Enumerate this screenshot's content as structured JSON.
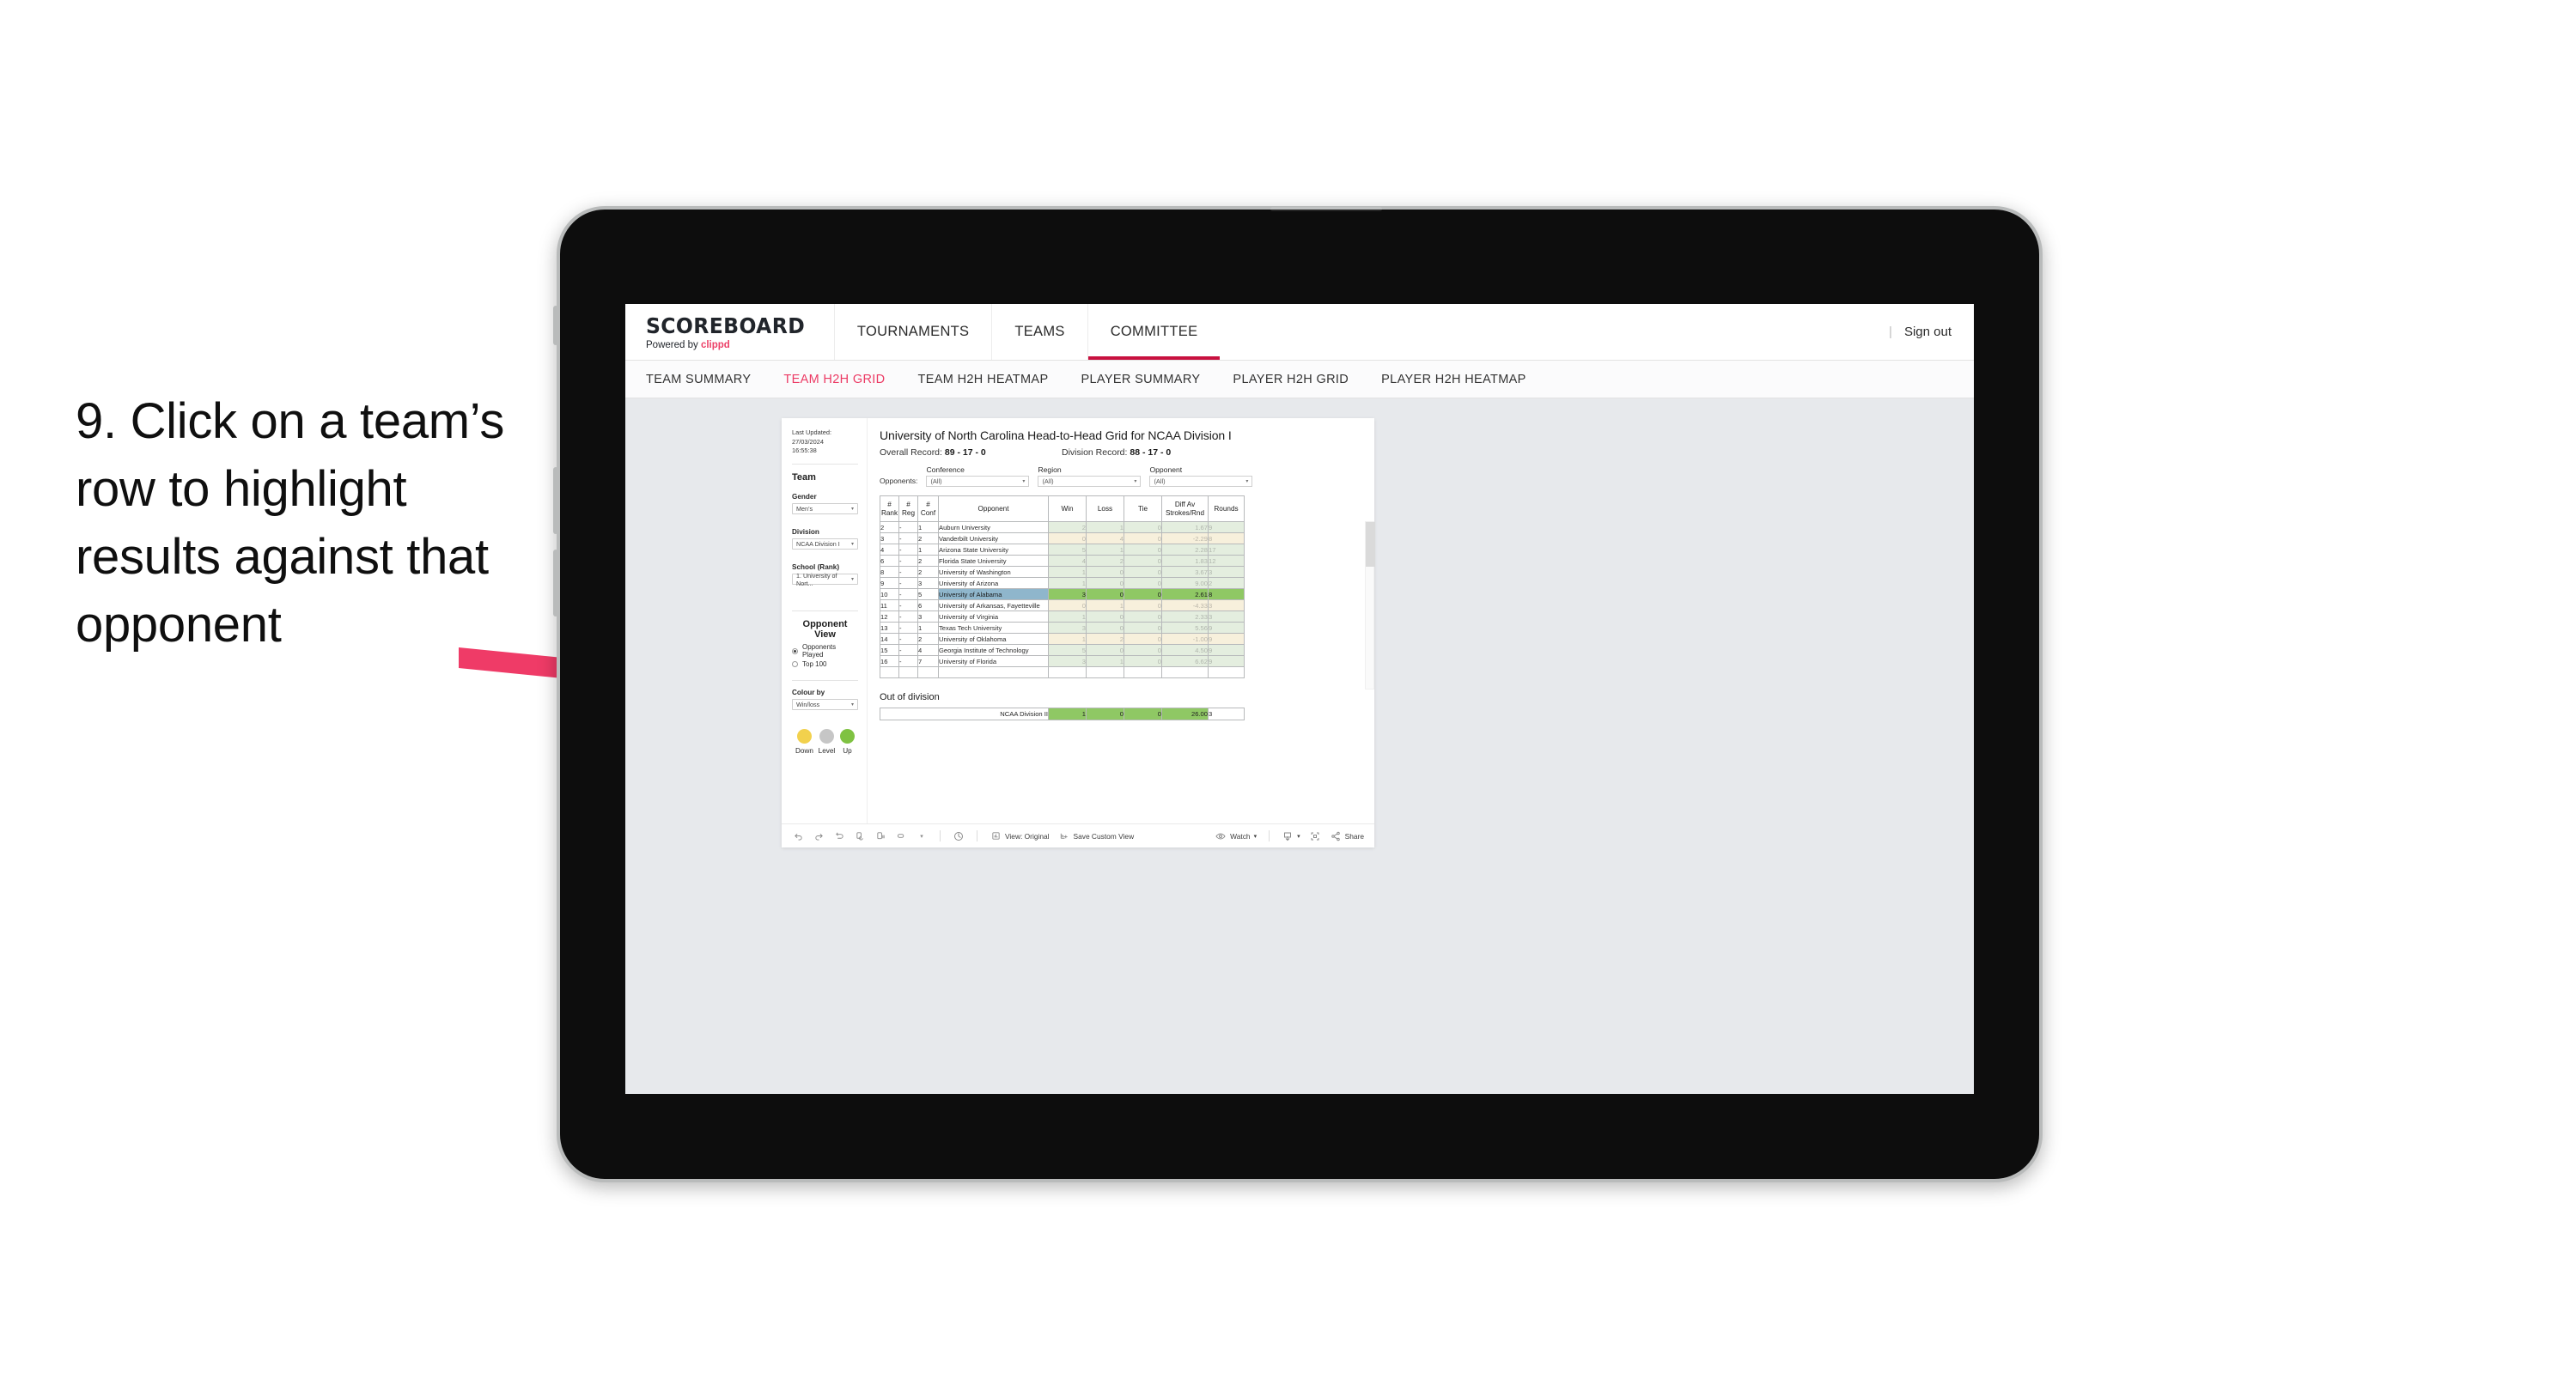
{
  "caption": "9. Click on a team’s row to highlight results against that opponent",
  "brand": {
    "title": "SCOREBOARD",
    "powered_prefix": "Powered by ",
    "powered_name": "clippd",
    "accent": "#ec4168"
  },
  "topnav": {
    "items": [
      {
        "label": "TOURNAMENTS",
        "active": false
      },
      {
        "label": "TEAMS",
        "active": false
      },
      {
        "label": "COMMITTEE",
        "active": true
      }
    ],
    "divider": "|",
    "signout": "Sign out",
    "active_underline_color": "#c8103f"
  },
  "subnav": {
    "items": [
      {
        "label": "TEAM SUMMARY",
        "active": false
      },
      {
        "label": "TEAM H2H GRID",
        "active": true
      },
      {
        "label": "TEAM H2H HEATMAP",
        "active": false
      },
      {
        "label": "PLAYER SUMMARY",
        "active": false
      },
      {
        "label": "PLAYER H2H GRID",
        "active": false
      },
      {
        "label": "PLAYER H2H HEATMAP",
        "active": false
      }
    ],
    "active_color": "#ec3a64"
  },
  "sidebar": {
    "last_updated_line1": "Last Updated: 27/03/2024",
    "last_updated_line2": "16:55:38",
    "team_heading": "Team",
    "gender_label": "Gender",
    "gender_value": "Men’s",
    "division_label": "Division",
    "division_value": "NCAA Division I",
    "school_label": "School (Rank)",
    "school_value": "1. University of Nort...",
    "opponent_view_heading": "Opponent View",
    "radio_options": [
      {
        "label": "Opponents Played",
        "selected": true
      },
      {
        "label": "Top 100",
        "selected": false
      }
    ],
    "colour_by_label": "Colour by",
    "colour_by_value": "Win/loss",
    "legend": [
      {
        "label": "Down",
        "color": "#f2d14d"
      },
      {
        "label": "Level",
        "color": "#c6c6c6"
      },
      {
        "label": "Up",
        "color": "#7fc242"
      }
    ]
  },
  "view": {
    "title": "University of North Carolina Head-to-Head Grid for NCAA Division I",
    "overall_record_label": "Overall Record:",
    "overall_record_value": "89 - 17 - 0",
    "division_record_label": "Division Record:",
    "division_record_value": "88 - 17 - 0",
    "opponents_label": "Opponents:",
    "filters": [
      {
        "label": "Conference",
        "value": "(All)"
      },
      {
        "label": "Region",
        "value": "(All)"
      },
      {
        "label": "Opponent",
        "value": "(All)"
      }
    ]
  },
  "grid": {
    "columns": [
      "# Rank",
      "# Reg",
      "# Conf",
      "Opponent",
      "Win",
      "Loss",
      "Tie",
      "Diff Av Strokes/Rnd",
      "Rounds"
    ],
    "column_head_lines": [
      [
        "#",
        "Rank"
      ],
      [
        "#",
        "Reg"
      ],
      [
        "#",
        "Conf"
      ],
      [
        "",
        "Opponent"
      ],
      [
        "",
        "Win"
      ],
      [
        "",
        "Loss"
      ],
      [
        "",
        "Tie"
      ],
      [
        "Diff Av",
        "Strokes/Rnd"
      ],
      [
        "",
        "Rounds"
      ]
    ],
    "rows": [
      {
        "rank": "2",
        "reg": "-",
        "conf": "1",
        "opponent": "Auburn University",
        "win": "2",
        "loss": "1",
        "tie": "0",
        "diff": "1.67",
        "rounds": "9",
        "tint": "green",
        "selected": false
      },
      {
        "rank": "3",
        "reg": "-",
        "conf": "2",
        "opponent": "Vanderbilt University",
        "win": "0",
        "loss": "4",
        "tie": "0",
        "diff": "-2.29",
        "rounds": "8",
        "tint": "yellow",
        "selected": false
      },
      {
        "rank": "4",
        "reg": "-",
        "conf": "1",
        "opponent": "Arizona State University",
        "win": "5",
        "loss": "1",
        "tie": "0",
        "diff": "2.28",
        "rounds": "17",
        "tint": "green",
        "selected": false
      },
      {
        "rank": "6",
        "reg": "-",
        "conf": "2",
        "opponent": "Florida State University",
        "win": "4",
        "loss": "2",
        "tie": "0",
        "diff": "1.83",
        "rounds": "12",
        "tint": "green",
        "selected": false
      },
      {
        "rank": "8",
        "reg": "-",
        "conf": "2",
        "opponent": "University of Washington",
        "win": "1",
        "loss": "0",
        "tie": "0",
        "diff": "3.67",
        "rounds": "3",
        "tint": "green",
        "selected": false
      },
      {
        "rank": "9",
        "reg": "-",
        "conf": "3",
        "opponent": "University of Arizona",
        "win": "1",
        "loss": "0",
        "tie": "0",
        "diff": "9.00",
        "rounds": "2",
        "tint": "green",
        "selected": false
      },
      {
        "rank": "10",
        "reg": "-",
        "conf": "5",
        "opponent": "University of Alabama",
        "win": "3",
        "loss": "0",
        "tie": "0",
        "diff": "2.61",
        "rounds": "8",
        "tint": "green",
        "selected": true
      },
      {
        "rank": "11",
        "reg": "-",
        "conf": "6",
        "opponent": "University of Arkansas, Fayetteville",
        "win": "0",
        "loss": "1",
        "tie": "0",
        "diff": "-4.33",
        "rounds": "3",
        "tint": "yellow",
        "selected": false
      },
      {
        "rank": "12",
        "reg": "-",
        "conf": "3",
        "opponent": "University of Virginia",
        "win": "1",
        "loss": "0",
        "tie": "0",
        "diff": "2.33",
        "rounds": "3",
        "tint": "green",
        "selected": false
      },
      {
        "rank": "13",
        "reg": "-",
        "conf": "1",
        "opponent": "Texas Tech University",
        "win": "3",
        "loss": "0",
        "tie": "0",
        "diff": "5.56",
        "rounds": "9",
        "tint": "green",
        "selected": false
      },
      {
        "rank": "14",
        "reg": "-",
        "conf": "2",
        "opponent": "University of Oklahoma",
        "win": "1",
        "loss": "2",
        "tie": "0",
        "diff": "-1.00",
        "rounds": "9",
        "tint": "yellow",
        "selected": false
      },
      {
        "rank": "15",
        "reg": "-",
        "conf": "4",
        "opponent": "Georgia Institute of Technology",
        "win": "5",
        "loss": "0",
        "tie": "0",
        "diff": "4.50",
        "rounds": "9",
        "tint": "green",
        "selected": false
      },
      {
        "rank": "16",
        "reg": "-",
        "conf": "7",
        "opponent": "University of Florida",
        "win": "3",
        "loss": "1",
        "tie": "0",
        "diff": "6.62",
        "rounds": "9",
        "tint": "green",
        "selected": false
      }
    ]
  },
  "out_of_division": {
    "title": "Out of division",
    "row": {
      "label": "NCAA Division II",
      "win": "1",
      "loss": "0",
      "tie": "0",
      "diff": "26.00",
      "rounds": "3"
    }
  },
  "toolbar": {
    "view_label": "View: Original",
    "save_label": "Save Custom View",
    "watch_label": "Watch",
    "share_label": "Share"
  }
}
